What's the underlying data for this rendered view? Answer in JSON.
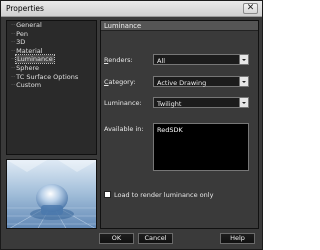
{
  "window": {
    "title": "Properties",
    "close_glyph": "✕"
  },
  "nav": {
    "items": [
      {
        "label": "General",
        "selected": false
      },
      {
        "label": "Pen",
        "selected": false
      },
      {
        "label": "3D",
        "selected": false
      },
      {
        "label": "Material",
        "selected": false
      },
      {
        "label": "Luminance",
        "selected": true
      },
      {
        "label": "Sphere",
        "selected": false
      },
      {
        "label": "TC Surface Options",
        "selected": false
      },
      {
        "label": "Custom",
        "selected": false
      }
    ]
  },
  "panel": {
    "header": "Luminance",
    "renders": {
      "label_prefix": "R",
      "label_rest": "enders:",
      "value": "All"
    },
    "category": {
      "label_prefix": "C",
      "label_rest": "ategory:",
      "value": "Active Drawing"
    },
    "luminance": {
      "label": "Luminance:",
      "value": "Twilight"
    },
    "available_in": {
      "label": "Available in:",
      "items": [
        "RedSDK"
      ]
    },
    "load_checkbox": {
      "label": "Load to render luminance only",
      "checked": false
    }
  },
  "buttons": {
    "ok": "OK",
    "cancel": "Cancel",
    "help": "Help"
  },
  "colors": {
    "window_bg": "#3a3a3a",
    "header_bg": "#555555",
    "list_bg": "#000000"
  }
}
